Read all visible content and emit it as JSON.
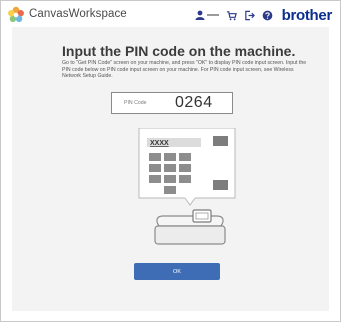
{
  "app": {
    "title": "CanvasWorkspace",
    "brand": "brother"
  },
  "header": {
    "icons": [
      "flower-logo-icon",
      "user-icon",
      "cart-icon",
      "logout-icon",
      "help-icon"
    ]
  },
  "main": {
    "title": "Input the PIN code on the machine.",
    "instructions": "Go to \"Get PIN Code\" screen on your machine, and press \"OK\" to display PIN code input screen. Input the PIN code below on PIN code input screen on your machine. For PIN code input screen, see Wireless Network Setup Guide.",
    "pin_label": "PIN Code",
    "pin_value": "0264",
    "screen_field_text": "XXXX",
    "ok_label": "OK"
  },
  "colors": {
    "accent": "#3e6db5",
    "brand": "#0c2f8f",
    "panel_bg": "#f3f3f3"
  }
}
